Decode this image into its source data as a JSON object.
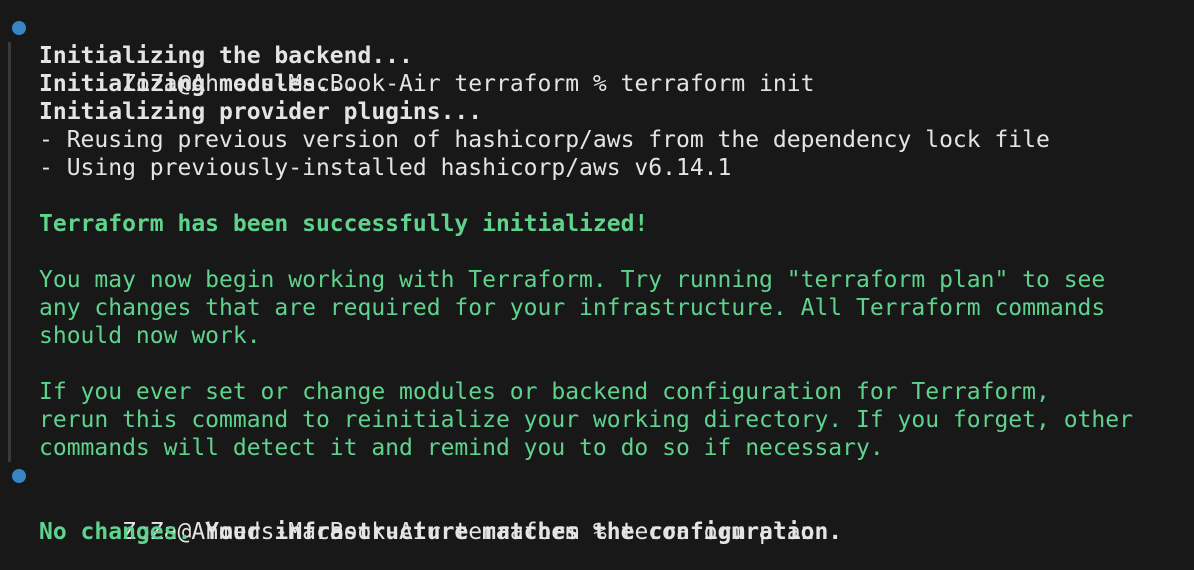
{
  "theme": {
    "background": "#181818",
    "text": "#e4e4e4",
    "green": "#5fd38d",
    "dot": "#3a84c5",
    "gutter": "#3a3a3a"
  },
  "init_command": {
    "prompt": "ZoZa@Ahmeds-MacBook-Air terraform % ",
    "command": "terraform init"
  },
  "init_output": {
    "backend": "Initializing the backend...",
    "modules": "Initializing modules...",
    "plugins": "Initializing provider plugins...",
    "reuse": "- Reusing previous version of hashicorp/aws from the dependency lock file",
    "using": "- Using previously-installed hashicorp/aws v6.14.1",
    "success": "Terraform has been successfully initialized!",
    "info_1": "You may now begin working with Terraform. Try running \"terraform plan\" to see",
    "info_2": "any changes that are required for your infrastructure. All Terraform commands",
    "info_3": "should now work.",
    "info_4": "If you ever set or change modules or backend configuration for Terraform,",
    "info_5": "rerun this command to reinitialize your working directory. If you forget, other",
    "info_6": "commands will detect it and remind you to do so if necessary."
  },
  "plan_command": {
    "prompt": "ZoZa@Ahmeds-MacBook-Air terraform % ",
    "command": "terraform plan"
  },
  "plan_output": {
    "no_changes": "No changes.",
    "matches": " Your infrastructure matches the configuration."
  }
}
